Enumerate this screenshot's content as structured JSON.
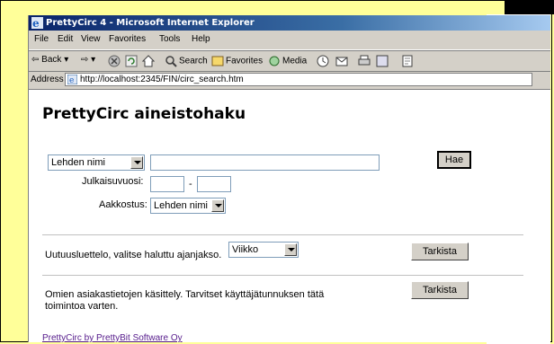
{
  "browser": {
    "title": "PrettyCirc 4 - Microsoft Internet Explorer",
    "menu": [
      "File",
      "Edit",
      "View",
      "Favorites",
      "Tools",
      "Help"
    ],
    "toolbar": {
      "back": "Back",
      "search": "Search",
      "favorites": "Favorites",
      "media": "Media"
    },
    "address_label": "Address",
    "url": "http://localhost:2345/FIN/circ_search.htm"
  },
  "page": {
    "heading": "PrettyCirc aineistohaku",
    "search": {
      "field_select": "Lehden nimi",
      "query_value": "",
      "button": "Hae",
      "year_label": "Julkaisuvuosi:",
      "year_sep": "-",
      "sort_label": "Aakkostus:",
      "sort_select": "Lehden nimi"
    },
    "news": {
      "text": "Uutuusluettelo, valitse haluttu ajanjakso.",
      "period_select": "Viikko",
      "button": "Tarkista"
    },
    "account": {
      "text_line1": "Omien asiakastietojen käsittely. Tarvitset käyttäjätunnuksen tätä",
      "text_line2": "toimintoa varten.",
      "button": "Tarkista"
    },
    "footer_link": "PrettyCirc by PrettyBit Software Oy"
  }
}
